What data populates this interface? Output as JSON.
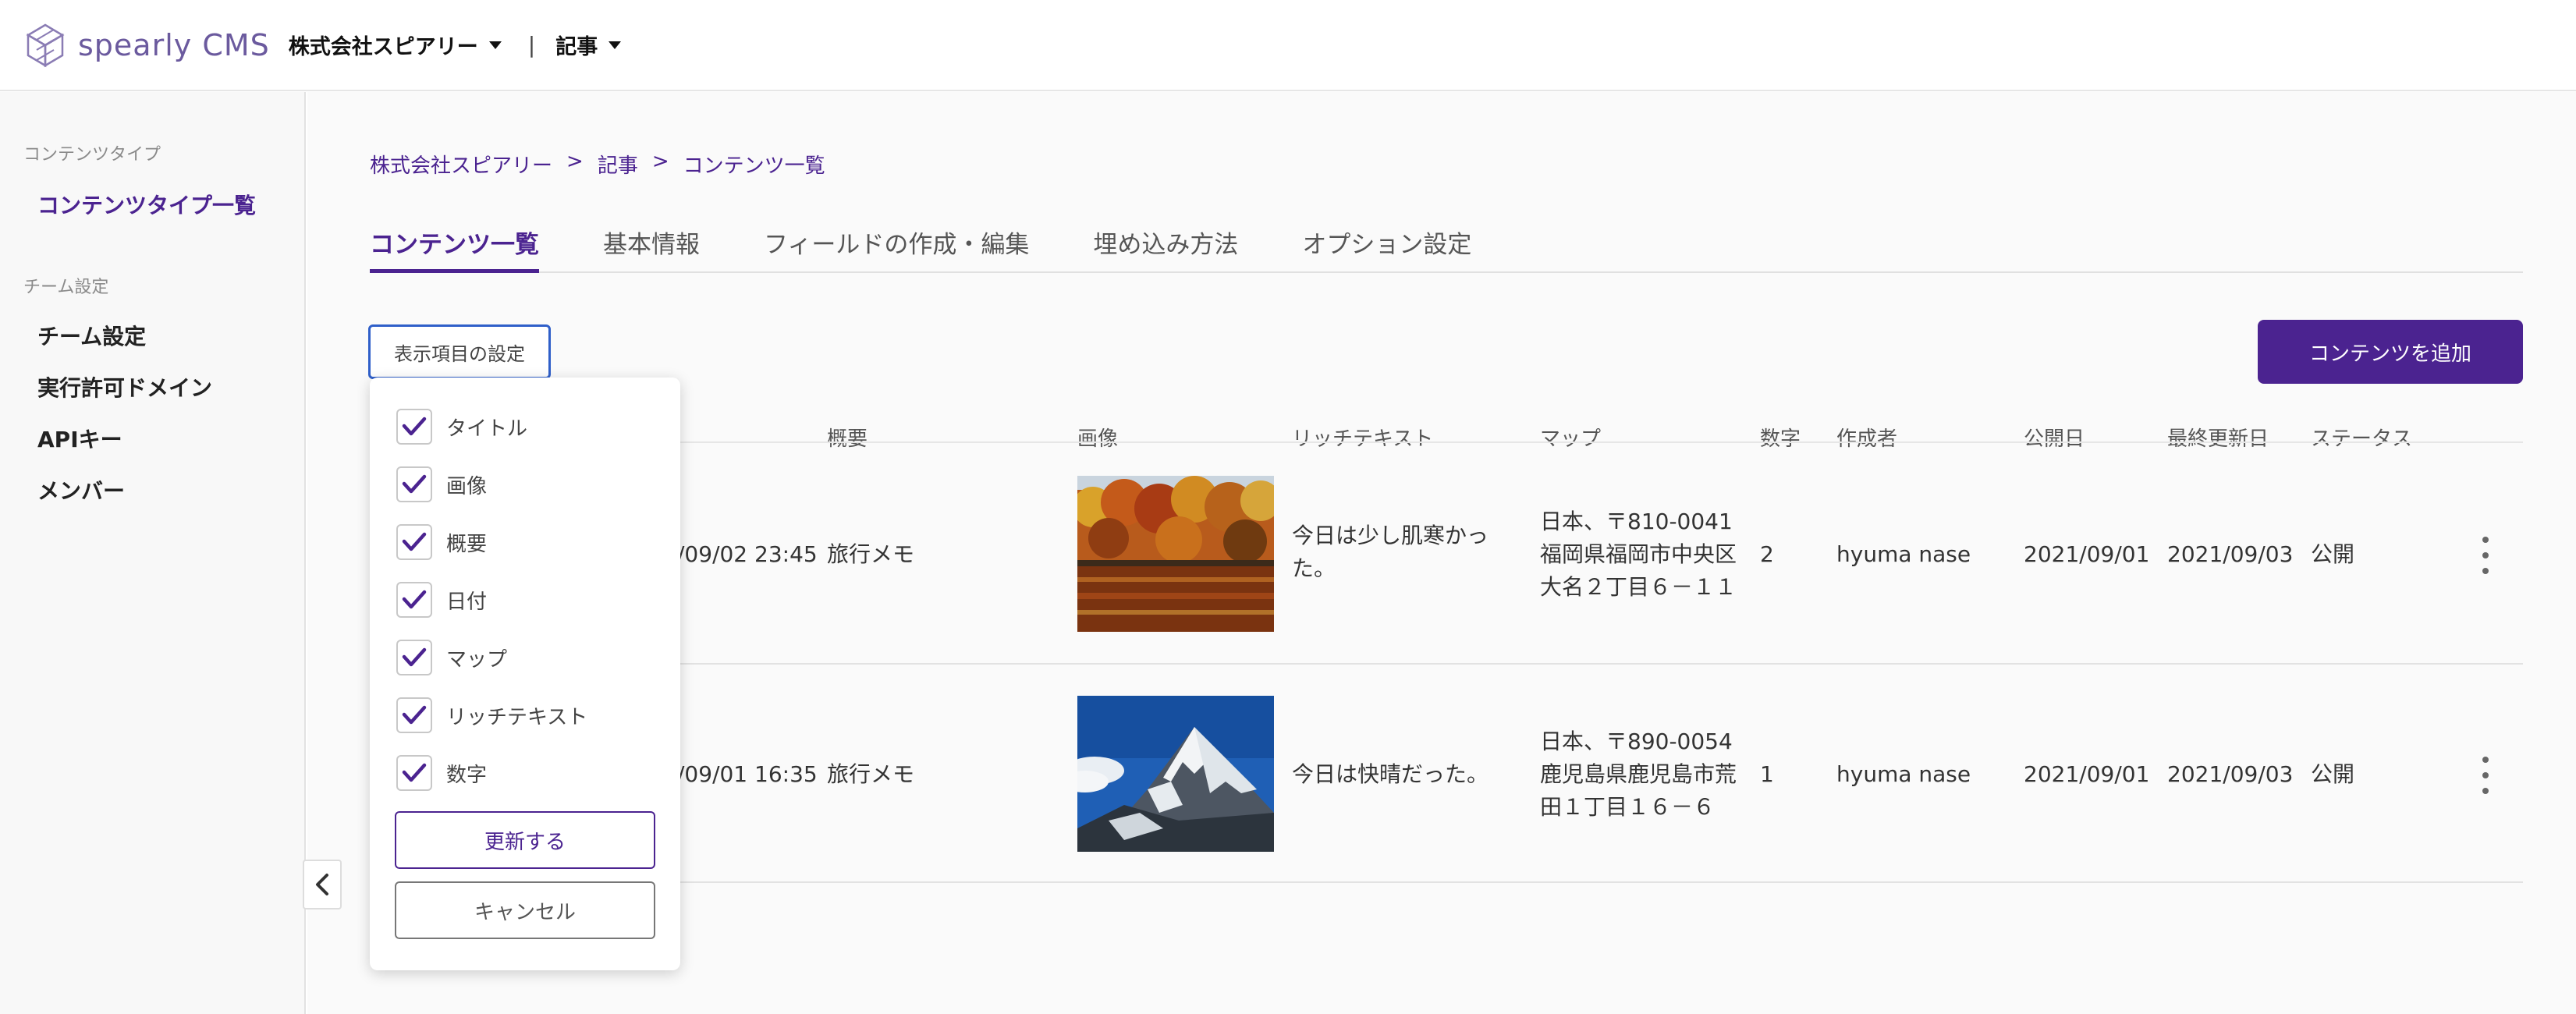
{
  "header": {
    "logo_text": "spearly CMS",
    "team_selector": "株式会社スピアリー",
    "divider": "|",
    "content_selector": "記事"
  },
  "sidebar": {
    "section_content": "コンテンツタイプ",
    "content_types": "コンテンツタイプ一覧",
    "section_team": "チーム設定",
    "items": [
      "チーム設定",
      "実行許可ドメイン",
      "APIキー",
      "メンバー"
    ]
  },
  "breadcrumb": [
    "株式会社スピアリー",
    "記事",
    "コンテンツ一覧"
  ],
  "breadcrumb_sep": ">",
  "tabs": [
    "コンテンツ一覧",
    "基本情報",
    "フィールドの作成・編集",
    "埋め込み方法",
    "オプション設定"
  ],
  "toolbar": {
    "display_settings": "表示項目の設定",
    "add_content": "コンテンツを追加"
  },
  "table": {
    "columns": [
      "概要",
      "画像",
      "リッチテキスト",
      "マップ",
      "数字",
      "作成者",
      "公開日",
      "最終更新日",
      "ステータス"
    ],
    "rows": [
      {
        "date": "/09/02 23:45",
        "summary": "旅行メモ",
        "richtext": [
          "今日は少し肌寒かっ",
          "た。"
        ],
        "map": [
          "日本、〒810-0041",
          "福岡県福岡市中央区",
          "大名２丁目６－１１"
        ],
        "number": "2",
        "author": "hyuma nase",
        "published": "2021/09/01",
        "updated": "2021/09/03",
        "status": "公開"
      },
      {
        "date": "/09/01 16:35",
        "summary": "旅行メモ",
        "richtext": [
          "今日は快晴だった。"
        ],
        "map": [
          "日本、〒890-0054",
          "鹿児島県鹿児島市荒",
          "田１丁目１６－６"
        ],
        "number": "1",
        "author": "hyuma nase",
        "published": "2021/09/01",
        "updated": "2021/09/03",
        "status": "公開"
      }
    ]
  },
  "popover": {
    "options": [
      "タイトル",
      "画像",
      "概要",
      "日付",
      "マップ",
      "リッチテキスト",
      "数字"
    ],
    "update": "更新する",
    "cancel": "キャンセル"
  },
  "colors": {
    "brand": "#4b2390",
    "focus": "#2f5fc9"
  }
}
